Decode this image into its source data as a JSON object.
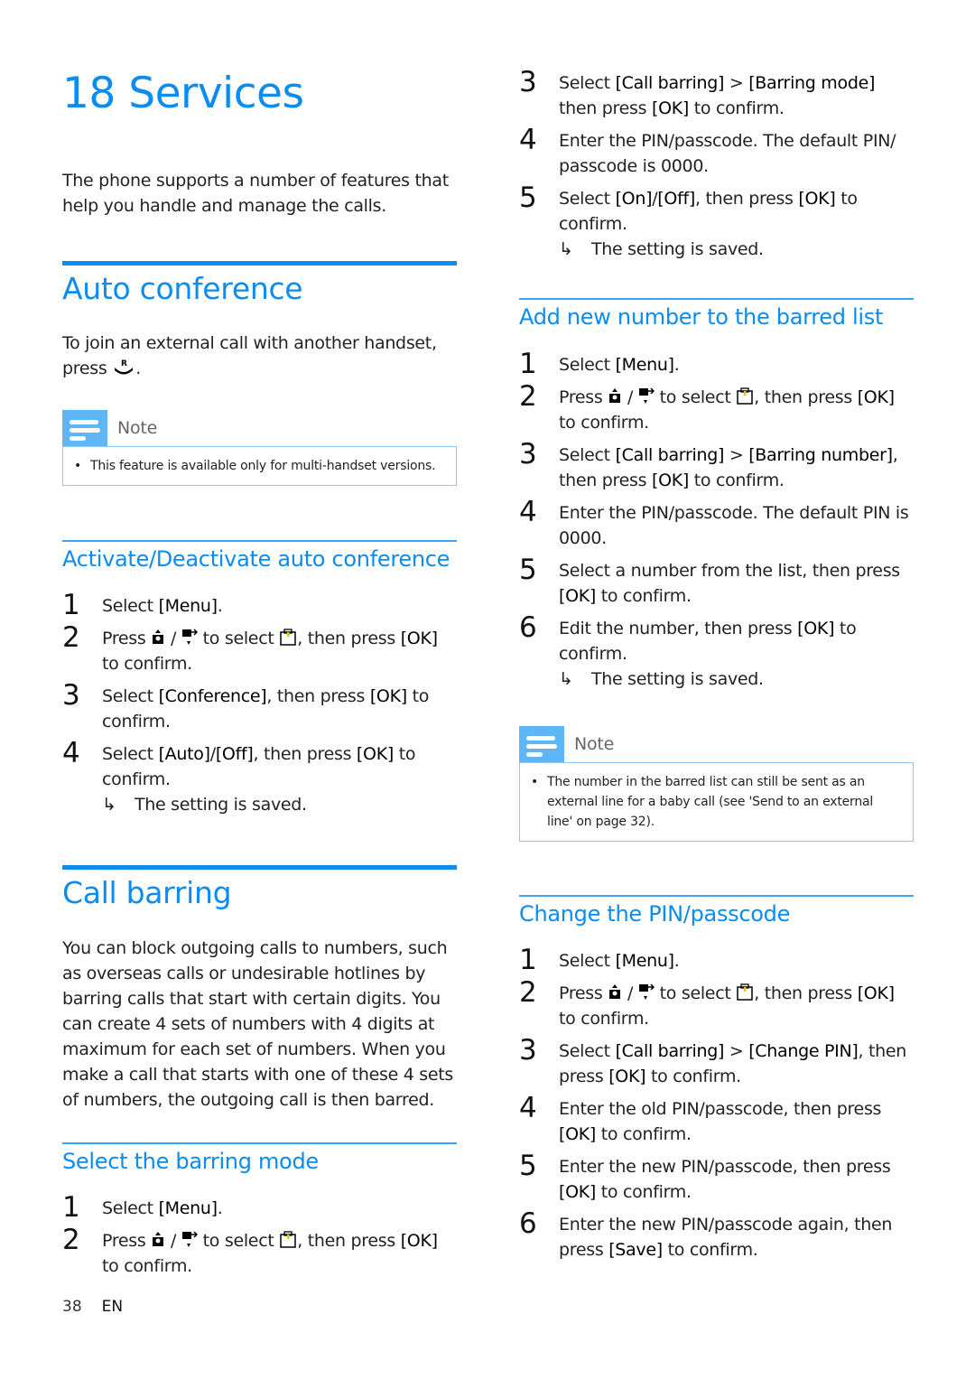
{
  "chapter": {
    "title": "18 Services",
    "intro": "The phone supports a number of features that help you handle and manage the calls."
  },
  "auto_conference": {
    "heading": "Auto conference",
    "intro_before_icon": "To join an external call with another handset, press",
    "intro_after_icon": ".",
    "icon": "flash-recall-icon",
    "note": {
      "label": "Note",
      "icon": "note-icon",
      "items": [
        "This feature is available only for multi-handset versions."
      ]
    },
    "activate": {
      "heading": "Activate/Deactivate auto conference",
      "steps": {
        "s1": {
          "num": "1",
          "pre": "Select ",
          "b": "[Menu]",
          "post": "."
        },
        "s2": {
          "num": "2",
          "press": "Press",
          "sep": "/",
          "to_select": "to select",
          "then": ", then press ",
          "ok": "[OK]",
          "post": " to confirm."
        },
        "s3": {
          "num": "3",
          "pre": "Select ",
          "b": "[Conference]",
          "mid": ", then press ",
          "b2": "[OK]",
          "post": " to confirm."
        },
        "s4": {
          "num": "4",
          "pre": "Select ",
          "b": "[Auto]",
          "slash": "/",
          "b2": "[Off]",
          "mid": ", then press ",
          "b3": "[OK]",
          "post": " to confirm.",
          "result": "The setting is saved."
        }
      }
    }
  },
  "call_barring": {
    "heading": "Call barring",
    "intro": "You can block outgoing calls to numbers, such as overseas calls or undesirable hotlines by barring calls that start with certain digits. You can create 4 sets of numbers with 4 digits at maximum for each set of numbers. When you make a call that starts with one of these 4 sets of numbers, the outgoing call is then barred.",
    "barring_mode": {
      "heading": "Select the barring mode",
      "steps": {
        "s1": {
          "num": "1",
          "pre": "Select ",
          "b": "[Menu]",
          "post": "."
        },
        "s2": {
          "num": "2",
          "press": "Press",
          "sep": "/",
          "to_select": "to select",
          "then": ", then press ",
          "ok": "[OK]",
          "post": " to confirm."
        },
        "s3": {
          "num": "3",
          "pre": "Select ",
          "b": "[Call barring]",
          "gt": " > ",
          "b2": "[Barring mode]",
          "mid": " then press ",
          "b3": "[OK]",
          "post": " to confirm."
        },
        "s4": {
          "num": "4",
          "text": "Enter the PIN/passcode. The default PIN/ passcode is 0000."
        },
        "s5": {
          "num": "5",
          "pre": "Select ",
          "b": "[On]",
          "slash": "/",
          "b2": "[Off]",
          "mid": ", then press ",
          "b3": "[OK]",
          "post": " to confirm.",
          "result": "The setting is saved."
        }
      }
    },
    "add_number": {
      "heading": "Add new number to the barred list",
      "steps": {
        "s1": {
          "num": "1",
          "pre": "Select ",
          "b": "[Menu]",
          "post": "."
        },
        "s2": {
          "num": "2",
          "press": "Press",
          "sep": "/",
          "to_select": "to select",
          "then": ", then press ",
          "ok": "[OK]",
          "post": " to confirm."
        },
        "s3": {
          "num": "3",
          "pre": "Select ",
          "b": "[Call barring]",
          "gt": " > ",
          "b2": "[Barring number]",
          "mid": ", then press ",
          "b3": "[OK]",
          "post": " to confirm."
        },
        "s4": {
          "num": "4",
          "text": "Enter the PIN/passcode. The default PIN is 0000."
        },
        "s5": {
          "num": "5",
          "pre": "Select a number from the list, then press ",
          "b": "[OK]",
          "post": " to confirm."
        },
        "s6": {
          "num": "6",
          "pre": "Edit the number, then press ",
          "b": "[OK]",
          "post": " to confirm.",
          "result": "The setting is saved."
        }
      },
      "note": {
        "label": "Note",
        "icon": "note-icon",
        "items": [
          "The number in the barred list can still be sent as an external line for a baby call (see 'Send to an external line' on page 32)."
        ]
      }
    },
    "change_pin": {
      "heading": "Change the PIN/passcode",
      "steps": {
        "s1": {
          "num": "1",
          "pre": "Select ",
          "b": "[Menu]",
          "post": "."
        },
        "s2": {
          "num": "2",
          "press": "Press",
          "sep": "/",
          "to_select": "to select",
          "then": ", then press ",
          "ok": "[OK]",
          "post": " to confirm."
        },
        "s3": {
          "num": "3",
          "pre": "Select ",
          "b": "[Call barring]",
          "gt": " > ",
          "b2": "[Change PIN]",
          "mid": ", then press ",
          "b3": "[OK]",
          "post": " to confirm."
        },
        "s4": {
          "num": "4",
          "pre": "Enter the old PIN/passcode, then press ",
          "b": "[OK]",
          "post": " to confirm."
        },
        "s5": {
          "num": "5",
          "pre": "Enter the new PIN/passcode, then press ",
          "b": "[OK]",
          "post": " to confirm."
        },
        "s6": {
          "num": "6",
          "pre": "Enter the new PIN/passcode again, then press ",
          "b": "[Save]",
          "post": " to confirm."
        }
      }
    }
  },
  "icons": {
    "up": "scroll-up-contacts-icon",
    "down": "scroll-down-redial-icon",
    "menu_target": "services-menu-icon",
    "result_arrow": "↳"
  },
  "footer": {
    "page_number": "38",
    "language": "EN"
  },
  "colors": {
    "accent": "#0a8cf0",
    "note_badge": "#5eb6f7",
    "note_border": "#8ccaf5"
  }
}
